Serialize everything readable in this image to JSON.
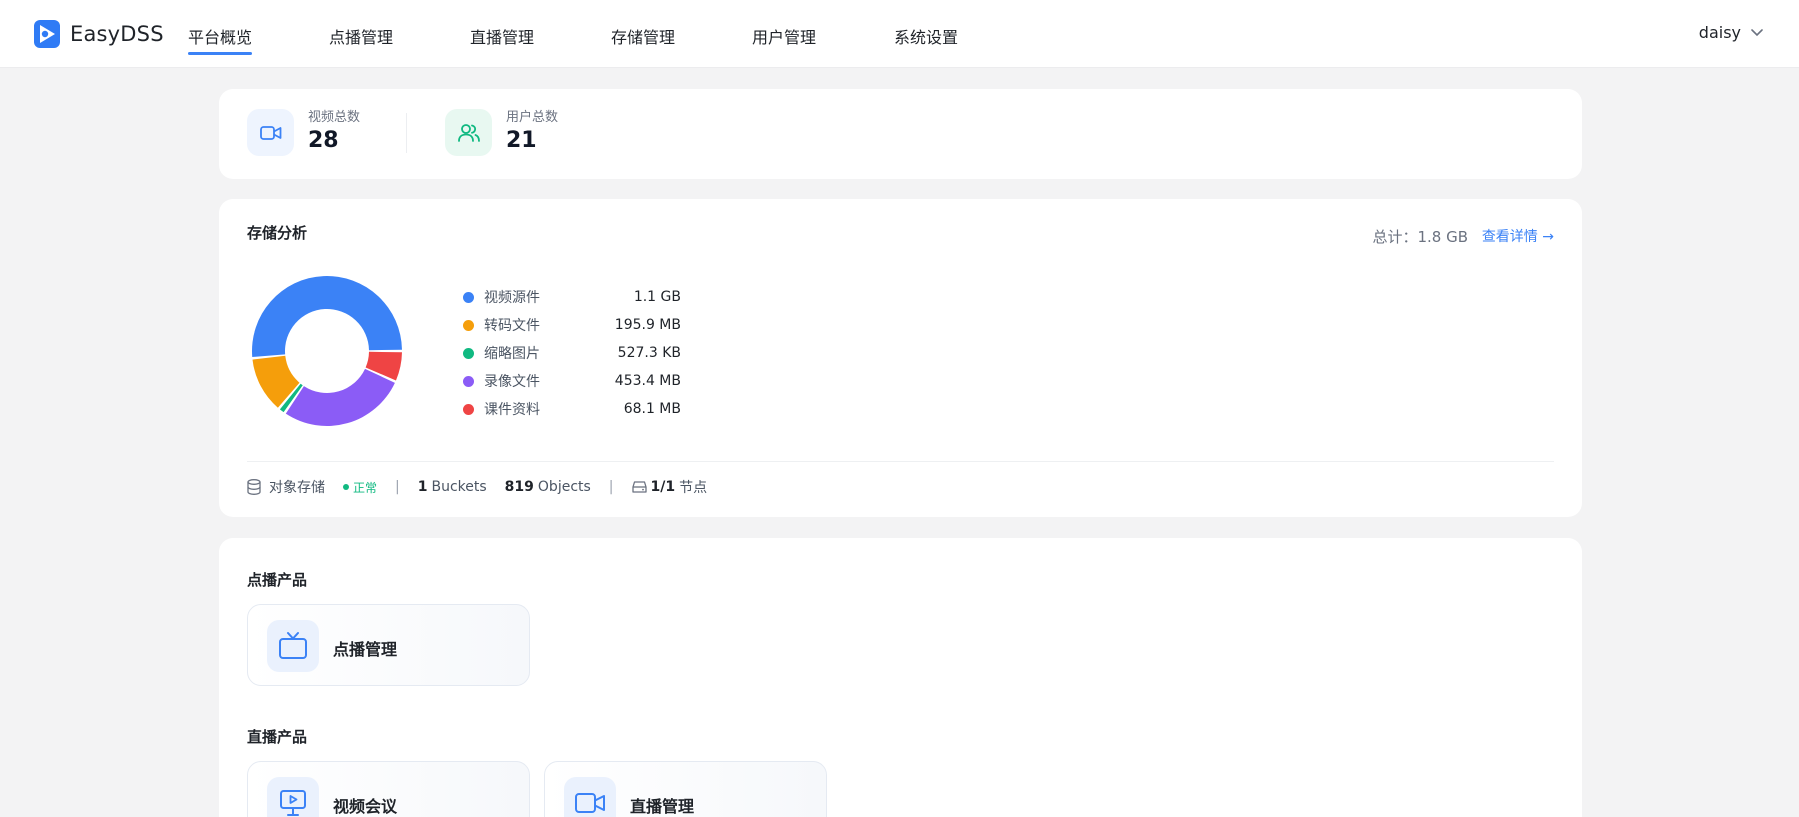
{
  "app": {
    "name": "EasyDSS"
  },
  "nav": {
    "items": [
      {
        "label": "平台概览",
        "active": true
      },
      {
        "label": "点播管理",
        "active": false
      },
      {
        "label": "直播管理",
        "active": false
      },
      {
        "label": "存储管理",
        "active": false
      },
      {
        "label": "用户管理",
        "active": false
      },
      {
        "label": "系统设置",
        "active": false
      }
    ],
    "user": "daisy"
  },
  "stats": [
    {
      "label": "视频总数",
      "value": "28",
      "icon": "video-camera-icon"
    },
    {
      "label": "用户总数",
      "value": "21",
      "icon": "users-icon"
    }
  ],
  "storage": {
    "title": "存储分析",
    "total": "总计：1.8 GB",
    "detail_link": "查看详情 →",
    "chart_data": {
      "type": "pie",
      "categories": [
        "视频源件",
        "转码文件",
        "缩略图片",
        "录像文件",
        "课件资料"
      ],
      "values": [
        1.1,
        195.9,
        527.3,
        453.4,
        68.1
      ],
      "display_values": [
        "1.1 GB",
        "195.9 MB",
        "527.3 KB",
        "453.4 MB",
        "68.1 MB"
      ],
      "colors": [
        "#3b82f6",
        "#f59e0b",
        "#10b981",
        "#8b5cf6",
        "#ef4444"
      ],
      "legend": "right"
    },
    "footer": {
      "label": "对象存储",
      "status": "正常",
      "buckets_count": "1",
      "buckets_label": "Buckets",
      "objects_count": "819",
      "objects_label": "Objects",
      "nodes_count": "1/1",
      "nodes_label": "节点",
      "separator": "|"
    }
  },
  "sections": [
    {
      "title": "点播产品",
      "products": [
        {
          "label": "点播管理",
          "icon": "tv-icon"
        }
      ]
    },
    {
      "title": "直播产品",
      "products": [
        {
          "label": "视频会议",
          "icon": "presentation-icon"
        },
        {
          "label": "直播管理",
          "icon": "video-camera-icon"
        }
      ]
    }
  ],
  "colors": {
    "accent": "#3b82f6",
    "success": "#10b981",
    "background": "#f3f3f4"
  }
}
